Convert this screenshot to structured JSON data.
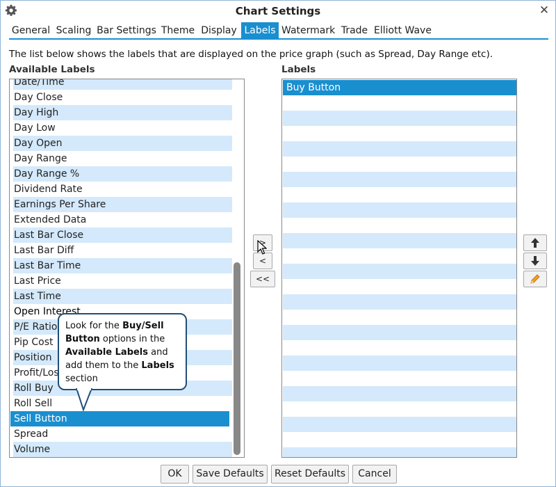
{
  "window": {
    "title": "Chart Settings"
  },
  "tabs": [
    "General",
    "Scaling",
    "Bar Settings",
    "Theme",
    "Display",
    "Labels",
    "Watermark",
    "Trade",
    "Elliott Wave"
  ],
  "active_tab": "Labels",
  "description": "The list below shows the labels that are displayed on the price graph (such as Spread, Day Range etc).",
  "available": {
    "heading": "Available Labels",
    "items": [
      "Date/Time",
      "Day Close",
      "Day High",
      "Day Low",
      "Day Open",
      "Day Range",
      "Day Range %",
      "Dividend Rate",
      "Earnings Per Share",
      "Extended Data",
      "Last Bar Close",
      "Last Bar Diff",
      "Last Bar Time",
      "Last Price",
      "Last Time",
      "Open Interest",
      "P/E Ratio",
      "Pip Cost",
      "Position",
      "Profit/Loss",
      "Roll Buy",
      "Roll Sell",
      "Sell Button",
      "Spread",
      "Volume"
    ],
    "selected": "Sell Button"
  },
  "labels": {
    "heading": "Labels",
    "items": [
      "Buy Button"
    ],
    "selected": "Buy Button"
  },
  "transfer_buttons": {
    "add": ">",
    "remove": "<",
    "remove_all": "<<"
  },
  "order_buttons": {
    "up_icon": "arrow-up-icon",
    "down_icon": "arrow-down-icon",
    "edit_icon": "pencil-icon"
  },
  "callout": {
    "t1": "Look for the ",
    "b1": "Buy/Sell Button",
    "t2": " options in the ",
    "b2": "Available Labels",
    "t3": " and add them to the ",
    "b3": "Labels",
    "t4": " section"
  },
  "footer": {
    "ok": "OK",
    "save_defaults": "Save Defaults",
    "reset_defaults": "Reset Defaults",
    "cancel": "Cancel"
  },
  "colors": {
    "accent": "#1a8fd0",
    "row_alt": "#d4e9fb",
    "callout_border": "#1f4e79"
  }
}
